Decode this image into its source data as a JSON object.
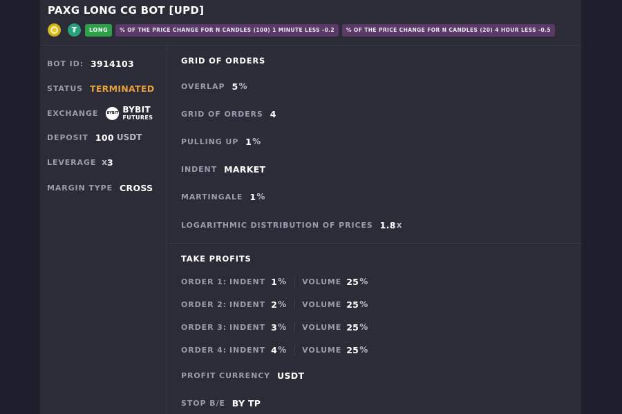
{
  "bot": {
    "title": "PAXG LONG CG BOT [UPD]",
    "coin_icon": "paxg-coin-icon",
    "quote_icon": "usdt-coin-icon",
    "quote_glyph": "₮",
    "direction": "LONG",
    "conditions": [
      "% OF THE PRICE CHANGE FOR N CANDLES (100) 1 MINUTE LESS -0.2",
      "% OF THE PRICE CHANGE FOR N CANDLES (20) 4 HOUR LESS -0.5"
    ]
  },
  "info": {
    "bot_id_label": "BOT ID:",
    "bot_id": "3914103",
    "status_label": "STATUS",
    "status": "TERMINATED",
    "exchange_label": "EXCHANGE",
    "exchange_logo_text": "BYBIT",
    "exchange_name": "BYBIT",
    "exchange_market": "FUTURES",
    "deposit_label": "DEPOSIT",
    "deposit_value": "100",
    "deposit_unit": "USDT",
    "leverage_label": "LEVERAGE",
    "leverage_prefix": "x",
    "leverage_value": "3",
    "margin_label": "MARGIN TYPE",
    "margin_value": "CROSS"
  },
  "grid": {
    "title": "GRID OF ORDERS",
    "overlap_label": "OVERLAP",
    "overlap_value": "5",
    "overlap_unit": "%",
    "orders_label": "GRID OF ORDERS",
    "orders_value": "4",
    "pulling_label": "PULLING UP",
    "pulling_value": "1",
    "pulling_unit": "%",
    "indent_label": "INDENT",
    "indent_value": "MARKET",
    "martingale_label": "MARTINGALE",
    "martingale_value": "1",
    "martingale_unit": "%",
    "log_label": "LOGARITHMIC DISTRIBUTION OF PRICES",
    "log_value": "1.8",
    "log_unit": "x"
  },
  "take_profits": {
    "title": "TAKE PROFITS",
    "indent_label": "INDENT",
    "volume_label": "VOLUME",
    "percent_unit": "%",
    "orders": [
      {
        "label": "ORDER 1:",
        "indent": "1",
        "volume": "25"
      },
      {
        "label": "ORDER 2:",
        "indent": "2",
        "volume": "25"
      },
      {
        "label": "ORDER 3:",
        "indent": "3",
        "volume": "25"
      },
      {
        "label": "ORDER 4:",
        "indent": "4",
        "volume": "25"
      }
    ],
    "profit_currency_label": "PROFIT CURRENCY",
    "profit_currency_value": "USDT",
    "stop_be_label": "STOP B/E",
    "stop_be_value": "BY TP"
  },
  "colors": {
    "page_bg": "#1e1e2c",
    "card_bg": "#2b2c37",
    "status_terminated": "#e8a23b",
    "long_badge": "#2fa04a",
    "condition_badge": "#5a3a66",
    "usdt": "#26a17b",
    "paxg": "#d4b21a"
  }
}
